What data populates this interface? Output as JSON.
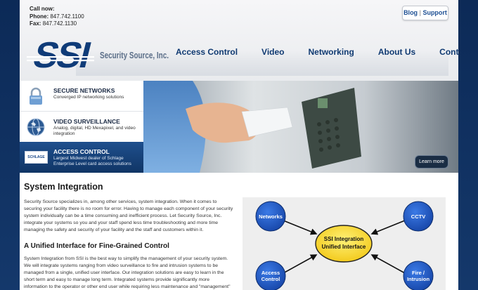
{
  "header": {
    "call_now": "Call now:",
    "phone_label": "Phone:",
    "phone": "847.742.1100",
    "fax_label": "Fax:",
    "fax": "847.742.1130",
    "blog": "Blog",
    "separator": "|",
    "support": "Support",
    "logo_text": "SSI",
    "logo_sub": "Security Source, Inc."
  },
  "nav": [
    "Access Control",
    "Video",
    "Networking",
    "About Us",
    "Contact"
  ],
  "features": [
    {
      "title": "SECURE NETWORKS",
      "desc": "Converged IP networking solutions",
      "icon": "lock-icon"
    },
    {
      "title": "VIDEO SURVEILLANCE",
      "desc": "Analog, digital, HD Mexapixel, and video integration",
      "icon": "globe-icon"
    },
    {
      "title": "ACCESS CONTROL",
      "desc": "Largest Midwest dealer of Schlage Enterprise Level card access solutions",
      "icon": "schlage-logo",
      "active": true
    }
  ],
  "schlage": "SCHLAGE",
  "hero": {
    "button": "Learn more"
  },
  "content": {
    "title": "System Integration",
    "p1": "Security Source specializes in, among other services, system integration. When it comes to securing your facility there is no room for error. Having to manage each component of your security system individually can be a time consuming and inefficient process. Let Security Source, Inc. integrate your systems so you and your staff spend less time troubleshooting and more time managing the safety and security of your facility and the staff and customers within it.",
    "subtitle": "A Unified Interface for Fine-Grained Control",
    "p2": "System Integration from SSI is the best way to simplify the management of your security system. We will integrate systems ranging from video surveillance to fire and intrusion systems to be managed from a single, unified user interface. Our integration solutions are easy to learn in the short term and easy to manage long term. Integrated systems provide significantly more information to the operator or other end user while requiring less maintenance and \"management\" hassles over the life of the system. Imagine being able to"
  },
  "diagram": {
    "center_line1": "SSI Integration",
    "center_line2": "Unified Interface",
    "nodes": [
      "Networks",
      "CCTV",
      "Access Control",
      "Fire / Intrusion"
    ],
    "node_lines": {
      "access1": "Access",
      "access2": "Control",
      "fire1": "Fire /",
      "fire2": "Intrusion"
    }
  },
  "colors": {
    "brand": "#103a72",
    "accent": "#1f4f8d",
    "node": "#1c57c9",
    "center": "#f5d31c"
  }
}
